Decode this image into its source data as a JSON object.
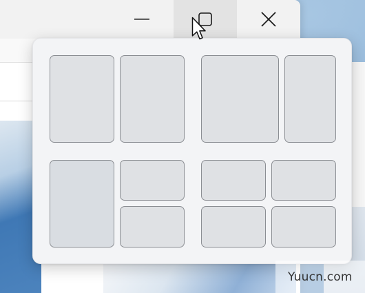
{
  "window": {
    "caption_buttons": [
      {
        "name": "minimize",
        "icon": "minimize-icon"
      },
      {
        "name": "maximize",
        "icon": "maximize-icon",
        "state": "hovered"
      },
      {
        "name": "close",
        "icon": "close-icon"
      }
    ]
  },
  "snap_layouts": {
    "layouts": [
      {
        "name": "two-equal-columns",
        "zones": 2
      },
      {
        "name": "two-columns-wide-left",
        "zones": 2
      },
      {
        "name": "column-plus-two-stacked",
        "zones": 3
      },
      {
        "name": "four-quadrants",
        "zones": 4
      }
    ]
  },
  "cursor": {
    "icon": "arrow-cursor-icon"
  },
  "watermark": {
    "text": "Yuucn.com"
  },
  "colors": {
    "flyout_background": "#f3f4f6",
    "zone_fill": "#dfe1e4",
    "zone_border": "#8b8e93",
    "titlebar": "#f2f2f2",
    "maximize_hover": "#e3e3e3"
  }
}
